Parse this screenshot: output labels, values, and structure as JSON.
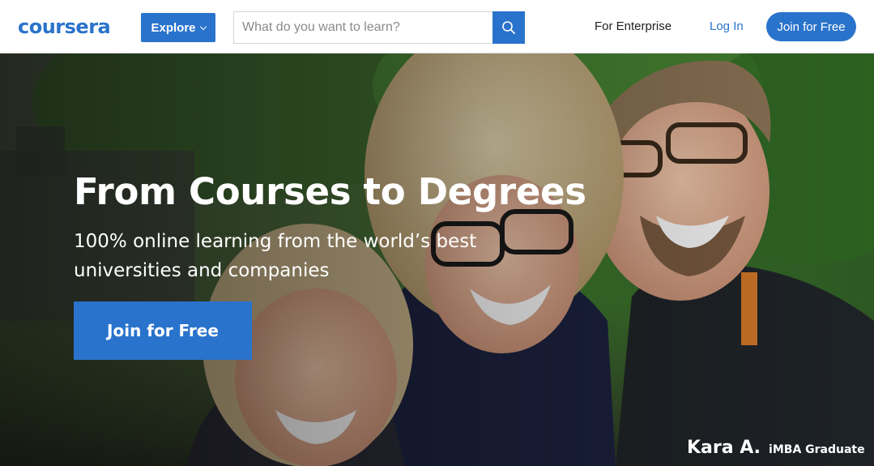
{
  "header": {
    "logo_text": "coursera",
    "explore_label": "Explore",
    "search": {
      "placeholder": "What do you want to learn?"
    },
    "nav": {
      "enterprise_label": "For Enterprise",
      "login_label": "Log In",
      "join_label": "Join for Free"
    }
  },
  "hero": {
    "title": "From Courses to Degrees",
    "subtitle": "100% online learning from the world’s best universities and companies",
    "cta_label": "Join for Free",
    "caption": {
      "name": "Kara A.",
      "role": "iMBA Graduate"
    }
  },
  "colors": {
    "brand": "#2a73cc",
    "header_bg": "#ffffff",
    "hero_text": "#ffffff"
  },
  "icons": [
    "chevron-down-icon",
    "search-icon"
  ]
}
